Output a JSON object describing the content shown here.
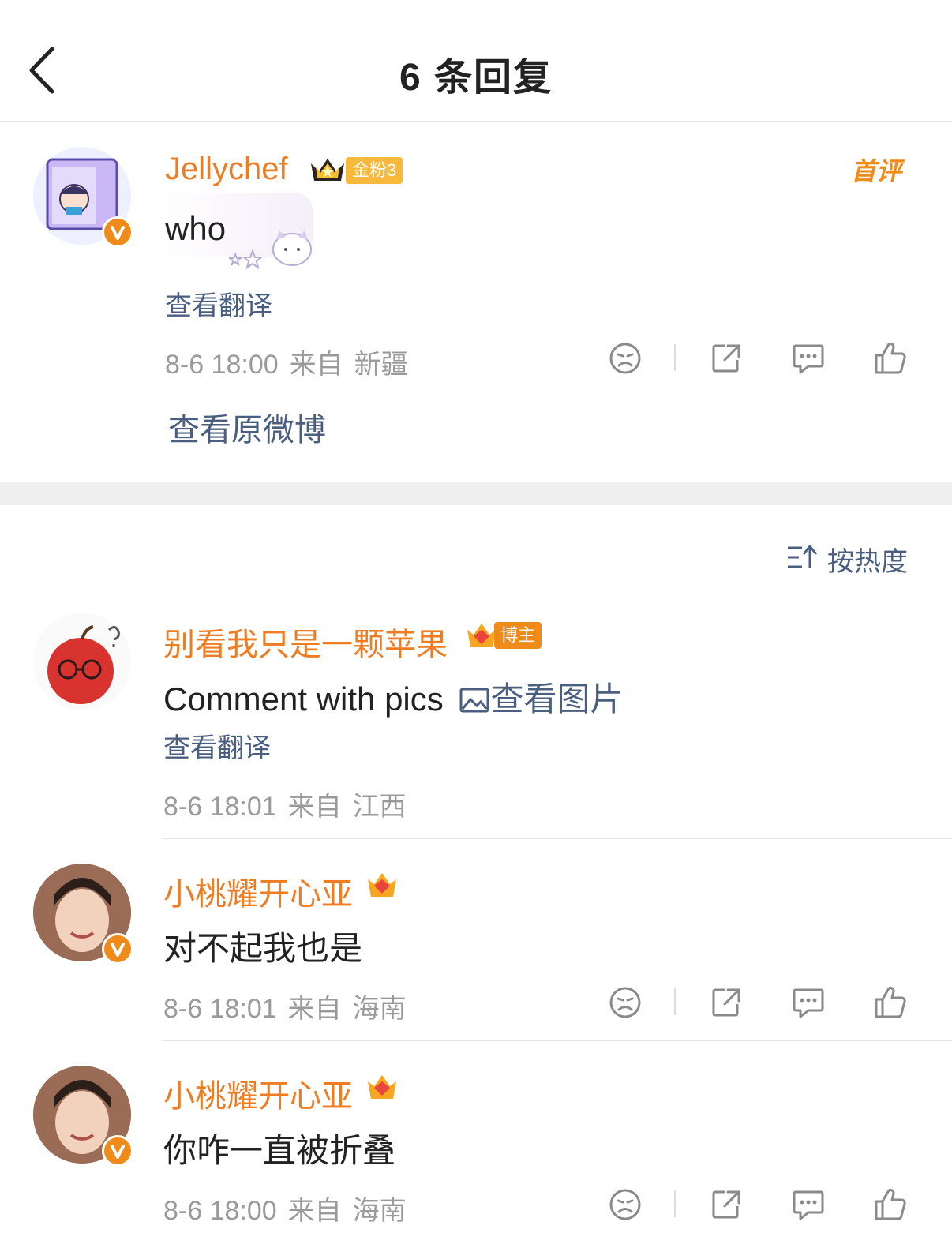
{
  "header": {
    "title": "6 条回复"
  },
  "main_comment": {
    "username": "Jellychef",
    "fan_badge": "金粉3",
    "first_label": "首评",
    "text": "who",
    "translate": "查看翻译",
    "time": "8-6 18:00",
    "from": "来自",
    "location": "新疆",
    "view_original": "查看原微博"
  },
  "sort": {
    "label": "按热度"
  },
  "replies": [
    {
      "username": "别看我只是一颗苹果",
      "badge": "博主",
      "text": "Comment with pics",
      "view_pics": "查看图片",
      "translate": "查看翻译",
      "time": "8-6 18:01",
      "from": "来自",
      "location": "江西"
    },
    {
      "username": "小桃耀开心亚",
      "text": "对不起我也是",
      "time": "8-6 18:01",
      "from": "来自",
      "location": "海南"
    },
    {
      "username": "小桃耀开心亚",
      "text": "你咋一直被折叠",
      "time": "8-6 18:00",
      "from": "来自",
      "location": "海南"
    }
  ],
  "colors": {
    "username": "#ef7c21",
    "link": "#4a5f7f",
    "meta": "#9a9a9a",
    "badge": "#f08a18"
  }
}
